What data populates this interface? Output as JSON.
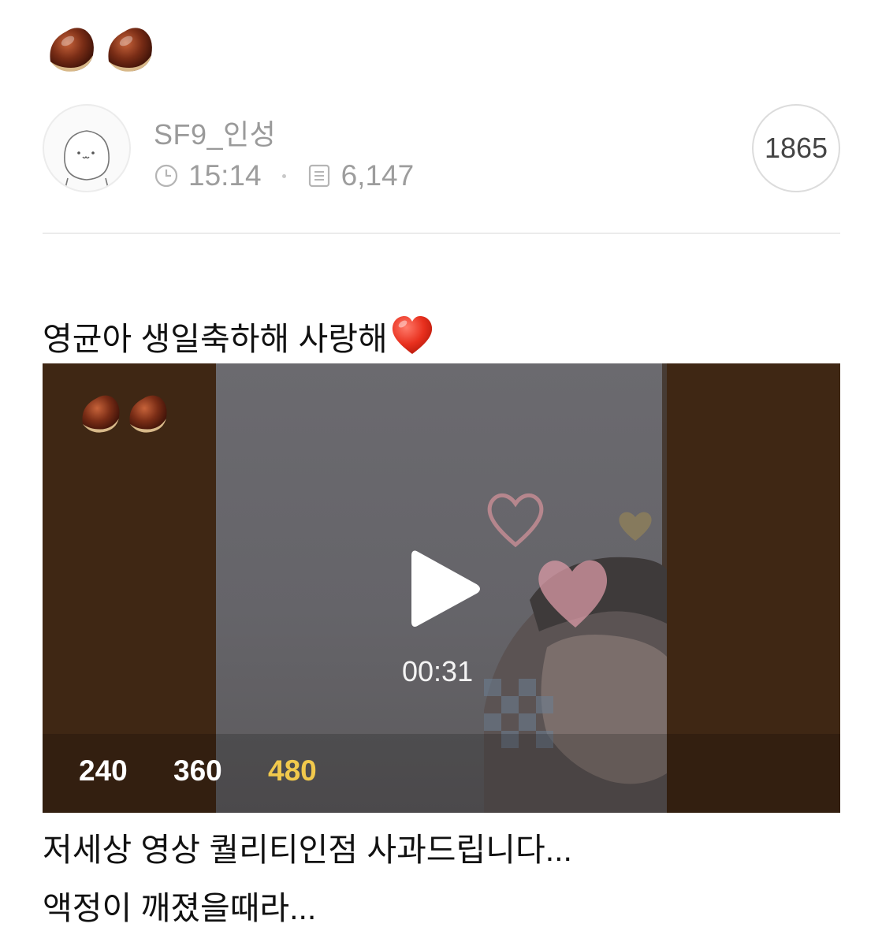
{
  "header": {
    "stickers": [
      "chestnut-icon",
      "chestnut-icon"
    ]
  },
  "author": {
    "name": "SF9_인성",
    "time": "15:14",
    "views": "6,147",
    "avatar_icon": "default-avatar-icon",
    "time_icon": "clock-icon",
    "views_icon": "document-icon"
  },
  "comments": {
    "count": "1865"
  },
  "post": {
    "title": "영균아 생일축하해 사랑해",
    "title_emoji": "red-heart-icon",
    "video": {
      "duration": "00:31",
      "play_icon": "play-icon",
      "quality_options": [
        "240",
        "360",
        "480"
      ],
      "selected_quality": "480",
      "selected_color": "#f2c94c"
    },
    "captions": [
      "저세상 영상 퀄리티인점 사과드립니다...",
      "액정이 깨졌을때라..."
    ]
  },
  "colors": {
    "video_background": "#3f2714",
    "meta_text": "#9d9d9d"
  }
}
